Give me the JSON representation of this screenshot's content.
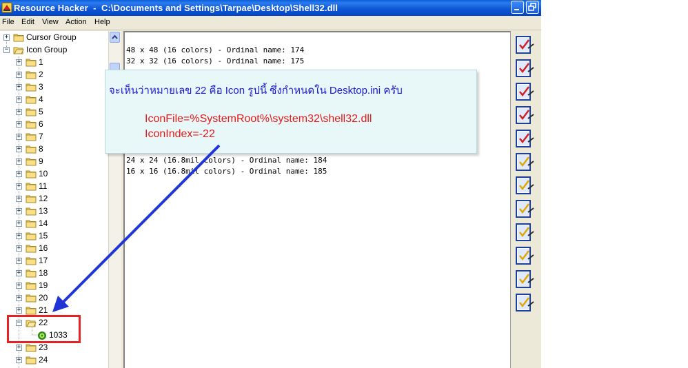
{
  "window": {
    "title": "Resource Hacker  -  C:\\Documents and Settings\\Tarpae\\Desktop\\Shell32.dll"
  },
  "menu": {
    "items": [
      {
        "label": "File"
      },
      {
        "label": "Edit"
      },
      {
        "label": "View"
      },
      {
        "label": "Action"
      },
      {
        "label": "Help"
      }
    ]
  },
  "tree": {
    "groups": [
      {
        "label": "Cursor Group",
        "expander": "+"
      },
      {
        "label": "Icon Group",
        "expander": "−"
      }
    ],
    "items": [
      {
        "label": "1"
      },
      {
        "label": "2"
      },
      {
        "label": "3"
      },
      {
        "label": "4"
      },
      {
        "label": "5"
      },
      {
        "label": "6"
      },
      {
        "label": "7"
      },
      {
        "label": "8"
      },
      {
        "label": "9"
      },
      {
        "label": "10"
      },
      {
        "label": "11"
      },
      {
        "label": "12"
      },
      {
        "label": "13"
      },
      {
        "label": "14"
      },
      {
        "label": "15"
      },
      {
        "label": "16"
      },
      {
        "label": "17"
      },
      {
        "label": "18"
      },
      {
        "label": "19"
      },
      {
        "label": "20"
      },
      {
        "label": "21"
      },
      {
        "label": "22"
      },
      {
        "label": "1033"
      },
      {
        "label": "23"
      },
      {
        "label": "24"
      }
    ]
  },
  "content": {
    "lines": [
      {
        "text": "48 x 48 (16 colors) - Ordinal name: 174"
      },
      {
        "text": "32 x 32 (16 colors) - Ordinal name: 175"
      },
      {
        "text": "24 x 24 (16.8mil colors) - Ordinal name: 184"
      },
      {
        "text": "16 x 16 (16.8mil colors) - Ordinal name: 185"
      }
    ]
  },
  "callout": {
    "line1": "จะเห็นว่าหมายเลข 22 คือ Icon รูปนี้ ซึ่งกำหนดใน Desktop.ini ครับ",
    "line2": "IconFile=%SystemRoot%\\system32\\shell32.dll",
    "line3": "IconIndex=-22"
  },
  "icon_strip": {
    "icon": "checklist-clipboard-icon",
    "count": 12
  },
  "colors": {
    "titlebar": "#0a5fd8",
    "callout_bg": "#e8f7f8",
    "callout_text": "#1a1ad0",
    "callout_code": "#e51a1a",
    "arrow": "#1f35d8",
    "highlight": "#e62222"
  }
}
